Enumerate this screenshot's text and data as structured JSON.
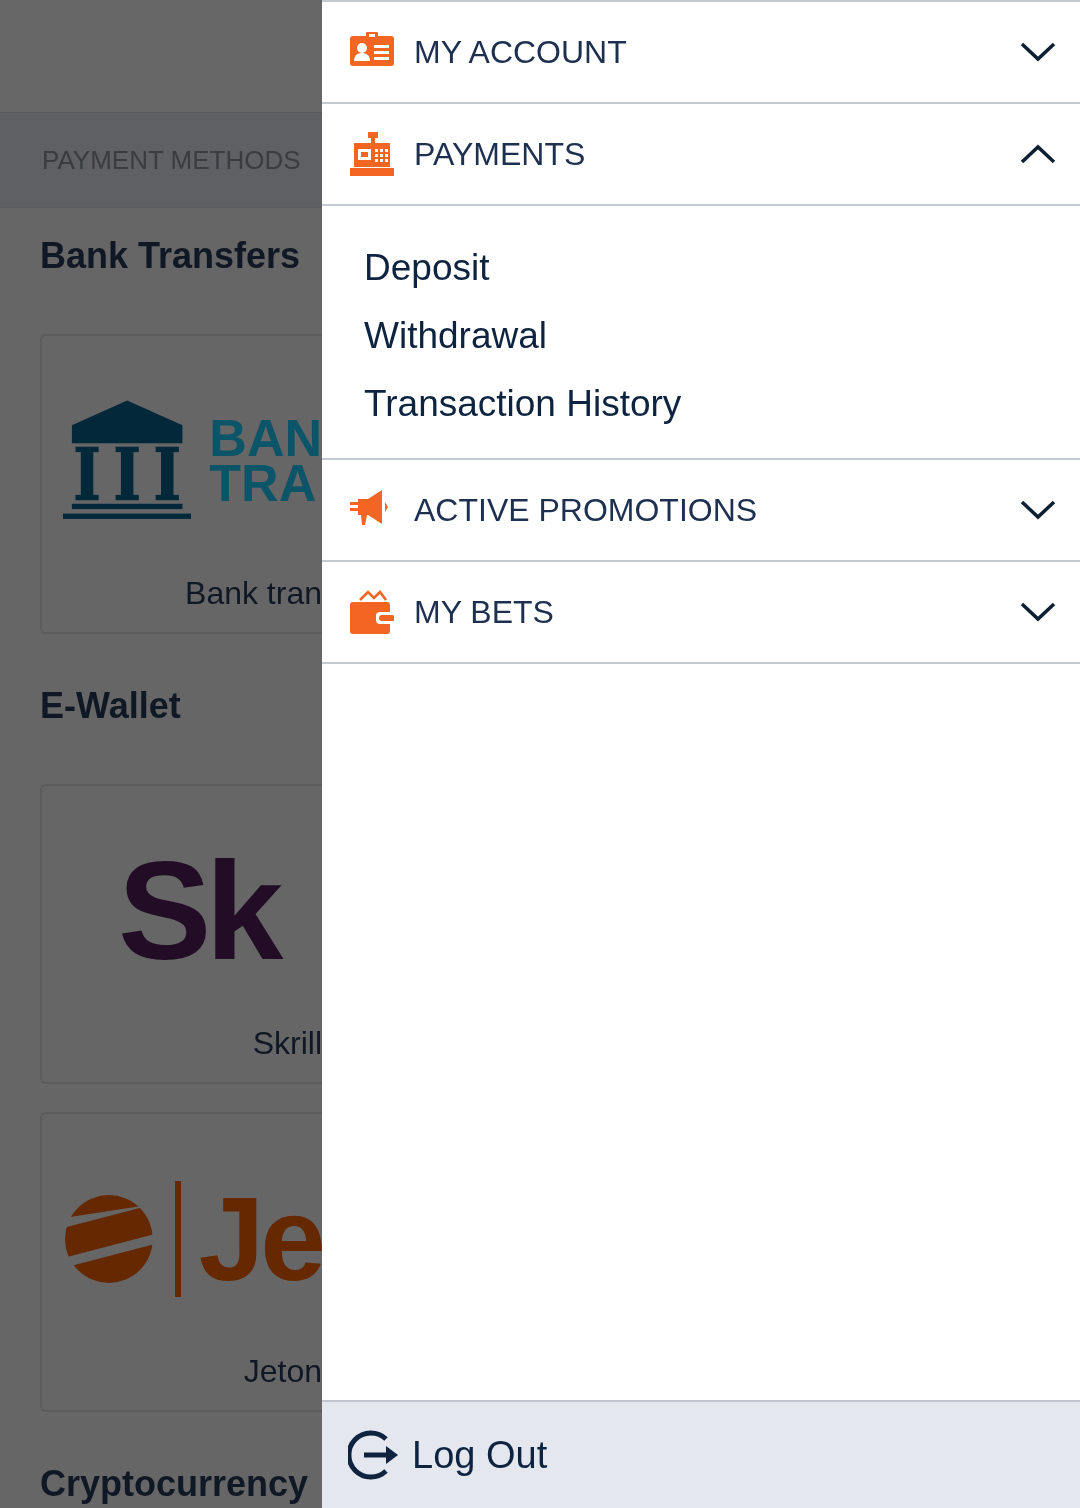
{
  "background_page": {
    "section_header": "PAYMENT METHODS",
    "groups": [
      {
        "title": "Bank Transfers",
        "cards": [
          {
            "kind": "bank",
            "logo_text": [
              "BAN",
              "TRA"
            ],
            "label": "Bank tran"
          }
        ]
      },
      {
        "title": "E-Wallet",
        "cards": [
          {
            "kind": "skrill",
            "logo_text": [
              "Sk"
            ],
            "label": "Skrill"
          },
          {
            "kind": "jeton",
            "logo_text": [
              "Je"
            ],
            "label": "Jeton"
          }
        ]
      },
      {
        "title": "Cryptocurrency"
      }
    ]
  },
  "menu": {
    "sections": [
      {
        "kind": "account",
        "title": "MY ACCOUNT",
        "expanded": false
      },
      {
        "kind": "payments",
        "title": "PAYMENTS",
        "expanded": true,
        "children": [
          {
            "label": "Deposit"
          },
          {
            "label": "Withdrawal"
          },
          {
            "label": "Transaction History"
          }
        ]
      },
      {
        "kind": "promotions",
        "title": "ACTIVE PROMOTIONS",
        "expanded": false
      },
      {
        "kind": "bets",
        "title": "MY BETS",
        "expanded": false
      }
    ],
    "logout": {
      "label": "Log Out"
    }
  }
}
